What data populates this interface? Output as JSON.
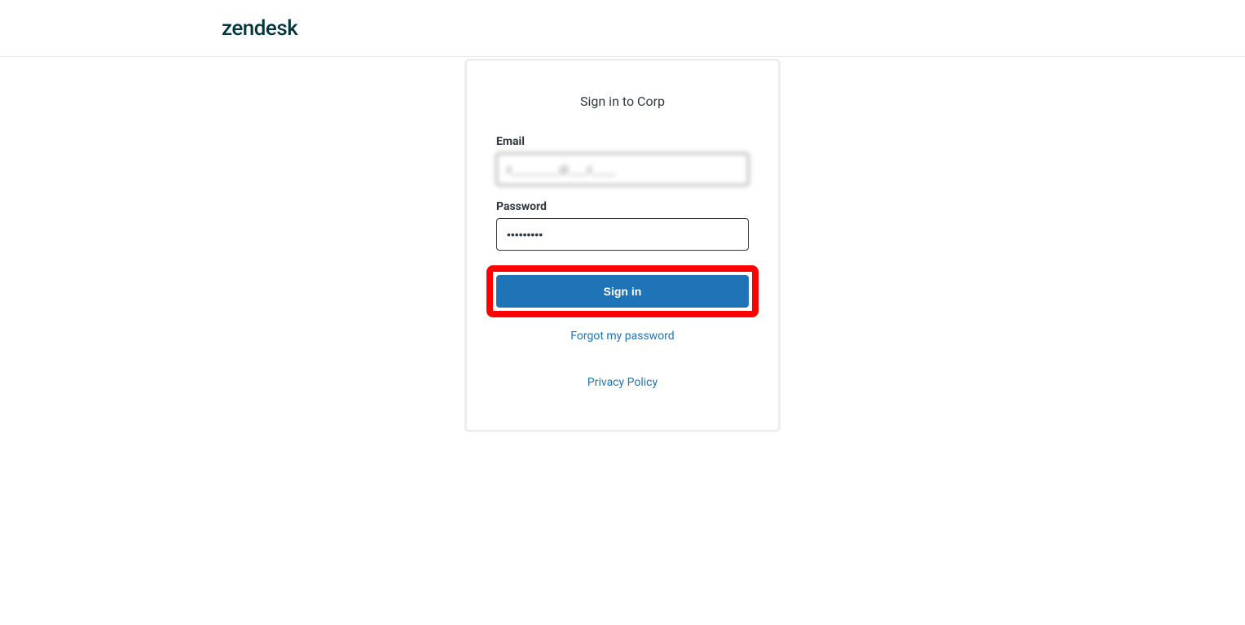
{
  "header": {
    "logo_text": "zendesk"
  },
  "signin": {
    "title": "Sign in to Corp",
    "email_label": "Email",
    "email_value": "li________@___il____",
    "password_label": "Password",
    "password_value": "•••••••••",
    "button_label": "Sign in",
    "forgot_link": "Forgot my password",
    "privacy_link": "Privacy Policy"
  },
  "highlight": {
    "color": "#ff0000"
  }
}
